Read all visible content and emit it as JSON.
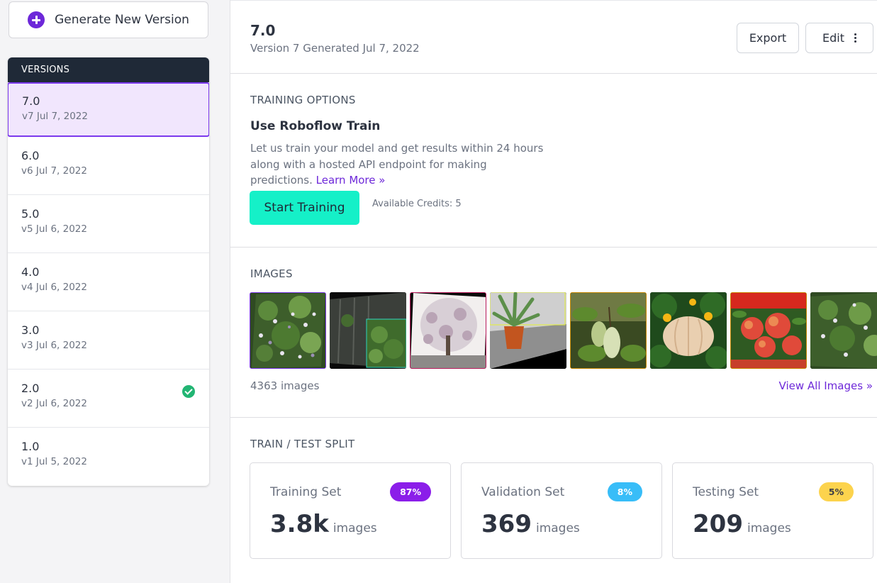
{
  "sidebar": {
    "generate_label": "Generate New Version",
    "versions_header": "VERSIONS",
    "versions": [
      {
        "num": "7.0",
        "date": "v7 Jul 7, 2022"
      },
      {
        "num": "6.0",
        "date": "v6 Jul 7, 2022"
      },
      {
        "num": "5.0",
        "date": "v5 Jul 6, 2022"
      },
      {
        "num": "4.0",
        "date": "v4 Jul 6, 2022"
      },
      {
        "num": "3.0",
        "date": "v3 Jul 6, 2022"
      },
      {
        "num": "2.0",
        "date": "v2 Jul 6, 2022"
      },
      {
        "num": "1.0",
        "date": "v1 Jul 5, 2022"
      }
    ],
    "active_version": "7.0",
    "checked_version": "2.0"
  },
  "header": {
    "version": "7.0",
    "subtitle": "Version 7 Generated Jul 7, 2022",
    "export_label": "Export",
    "edit_label": "Edit"
  },
  "training": {
    "section_title": "TRAINING OPTIONS",
    "heading": "Use Roboflow Train",
    "description": "Let us train your model and get results within 24 hours along with a hosted API endpoint for making predictions.",
    "learn_more": "Learn More »",
    "start_label": "Start Training",
    "credits": "Available Credits: 5"
  },
  "images": {
    "section_title": "IMAGES",
    "count_text": "4363 images",
    "view_all": "View All Images »",
    "thumbnails": [
      "flower-bush",
      "ivy-wall",
      "cherry-tree",
      "aloe-pot",
      "melons",
      "pumpkin",
      "peach-trees",
      "flower-bush-2"
    ]
  },
  "split": {
    "section_title": "TRAIN / TEST SPLIT",
    "cards": [
      {
        "label": "Training Set",
        "badge": "87%",
        "value": "3.8k",
        "unit": "images",
        "badge_bg": "#8b1ee9",
        "badge_fg": "#ffffff"
      },
      {
        "label": "Validation Set",
        "badge": "8%",
        "value": "369",
        "unit": "images",
        "badge_bg": "#38bdf8",
        "badge_fg": "#ffffff"
      },
      {
        "label": "Testing Set",
        "badge": "5%",
        "value": "209",
        "unit": "images",
        "badge_bg": "#fcd34d",
        "badge_fg": "#3f3f46"
      }
    ]
  },
  "colors": {
    "accent": "#6d28d9",
    "primary_button": "#15f0c8",
    "sidebar_header": "#1f2937",
    "success": "#22b573"
  }
}
